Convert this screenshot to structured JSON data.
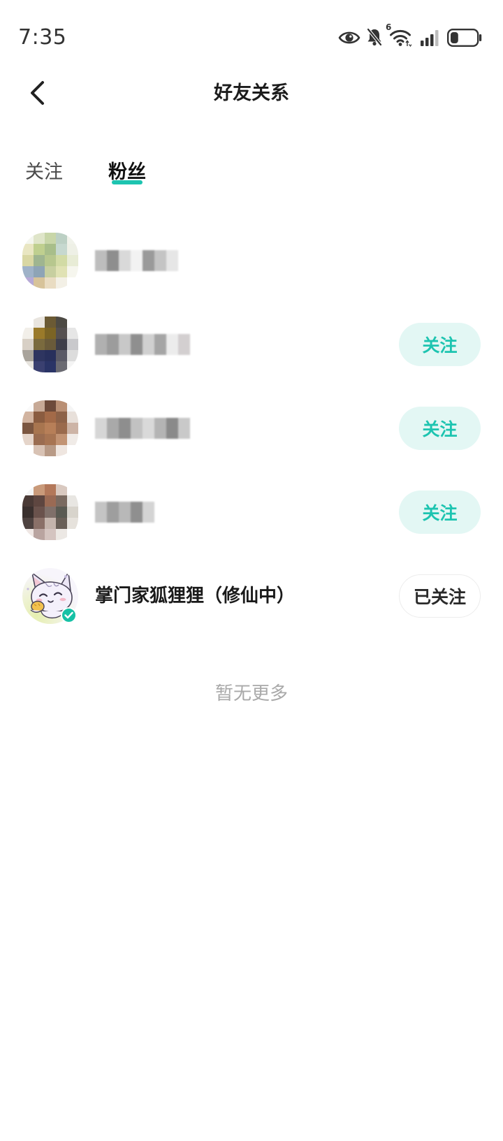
{
  "status_bar": {
    "time": "7:35",
    "wifi_generation": "6",
    "battery_level": 0.3
  },
  "header": {
    "title": "好友关系"
  },
  "tabs": [
    {
      "label": "关注",
      "active": false
    },
    {
      "label": "粉丝",
      "active": true
    }
  ],
  "followers": [
    {},
    {
      "follow_button": "关注"
    },
    {
      "follow_button": "关注"
    },
    {
      "follow_button": "关注"
    },
    {
      "name": "掌门家狐狸狸（修仙中）",
      "follow_button": "已关注",
      "verified": true
    }
  ],
  "footer": {
    "end_of_list": "暂无更多"
  },
  "colors": {
    "accent": "#1dc4b0",
    "accent_soft": "#e3f7f4",
    "text": "#222222",
    "muted": "#a9a9a9"
  },
  "icons": [
    "eye-icon",
    "bell-off-icon",
    "wifi-icon",
    "signal-icon",
    "battery-icon",
    "chevron-left-icon",
    "verified-badge-icon"
  ]
}
